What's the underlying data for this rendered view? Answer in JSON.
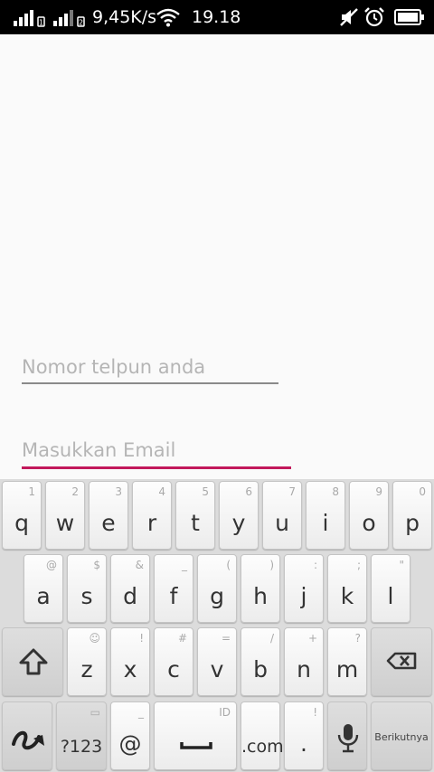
{
  "status_bar": {
    "speed": "9,45K/s",
    "time": "19.18",
    "icons": [
      "signal-sim1-icon",
      "signal-sim2-icon",
      "wifi-icon",
      "mute-icon",
      "alarm-icon",
      "battery-icon"
    ]
  },
  "form": {
    "phone_placeholder": "Nomor telpun anda",
    "email_placeholder": "Masukkan Email",
    "accent_color": "#c2185b"
  },
  "keyboard": {
    "row1": [
      {
        "key": "q",
        "hint": "1"
      },
      {
        "key": "w",
        "hint": "2"
      },
      {
        "key": "e",
        "hint": "3"
      },
      {
        "key": "r",
        "hint": "4"
      },
      {
        "key": "t",
        "hint": "5"
      },
      {
        "key": "y",
        "hint": "6"
      },
      {
        "key": "u",
        "hint": "7"
      },
      {
        "key": "i",
        "hint": "8"
      },
      {
        "key": "o",
        "hint": "9"
      },
      {
        "key": "p",
        "hint": "0"
      }
    ],
    "row2": [
      {
        "key": "a",
        "hint": "@"
      },
      {
        "key": "s",
        "hint": "$"
      },
      {
        "key": "d",
        "hint": "&"
      },
      {
        "key": "f",
        "hint": "_"
      },
      {
        "key": "g",
        "hint": "("
      },
      {
        "key": "h",
        "hint": ")"
      },
      {
        "key": "j",
        "hint": ":"
      },
      {
        "key": "k",
        "hint": ";"
      },
      {
        "key": "l",
        "hint": "\""
      }
    ],
    "row3": [
      {
        "key": "z",
        "hint": "☺"
      },
      {
        "key": "x",
        "hint": "!"
      },
      {
        "key": "c",
        "hint": "#"
      },
      {
        "key": "v",
        "hint": "="
      },
      {
        "key": "b",
        "hint": "/"
      },
      {
        "key": "n",
        "hint": "+"
      },
      {
        "key": "m",
        "hint": "?"
      }
    ],
    "symbols_label": "?123",
    "at_label": "@",
    "at_hint": "_",
    "space_hint": "ID",
    "dotcom_label": ".com",
    "period_label": ".",
    "period_hint": "!",
    "enter_label": "Berikutnya"
  }
}
